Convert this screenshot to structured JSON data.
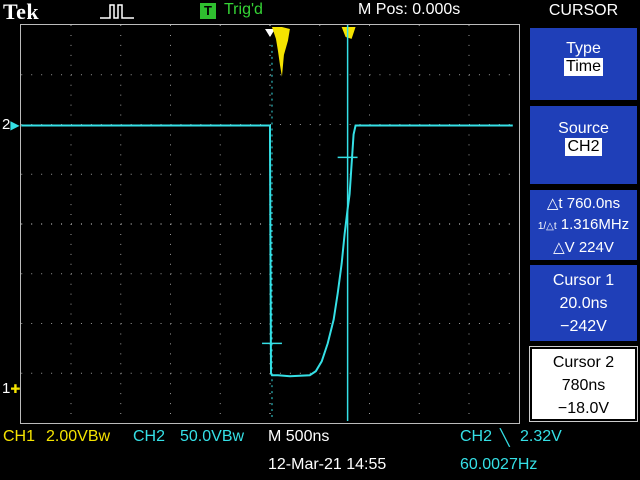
{
  "header": {
    "brand": "Tek",
    "trigger_icon": "T",
    "trigger_status": "Trig'd",
    "horizontal_position": "M Pos: 0.000s"
  },
  "menu": {
    "title": "CURSOR",
    "type_label": "Type",
    "type_value": "Time",
    "source_label": "Source",
    "source_value": "CH2",
    "delta_t": "△t 760.0ns",
    "delta_f": "1.316MHz",
    "delta_v": "△V 224V",
    "cursor1_label": "Cursor 1",
    "cursor1_time": "20.0ns",
    "cursor1_value": "−242V",
    "cursor2_label": "Cursor 2",
    "cursor2_time": "780ns",
    "cursor2_value": "−18.0V"
  },
  "footer": {
    "ch1_label": "CH1",
    "ch1_scale": "2.00VBᴡ",
    "ch2_label": "CH2",
    "ch2_scale": "50.0VBᴡ",
    "timebase": "M 500ns",
    "trigger_source": "CH2",
    "trigger_slope": "╲",
    "trigger_level": "2.32V",
    "date": "12-Mar-21 14:55",
    "frequency": "60.0027Hz"
  },
  "markers": {
    "ch1_marker": "1",
    "ch2_marker": "2"
  },
  "colors": {
    "ch1": "#f5e300",
    "ch2": "#35e0e6",
    "menu_panel": "#1f3fb8",
    "trigger": "#35d335"
  }
}
